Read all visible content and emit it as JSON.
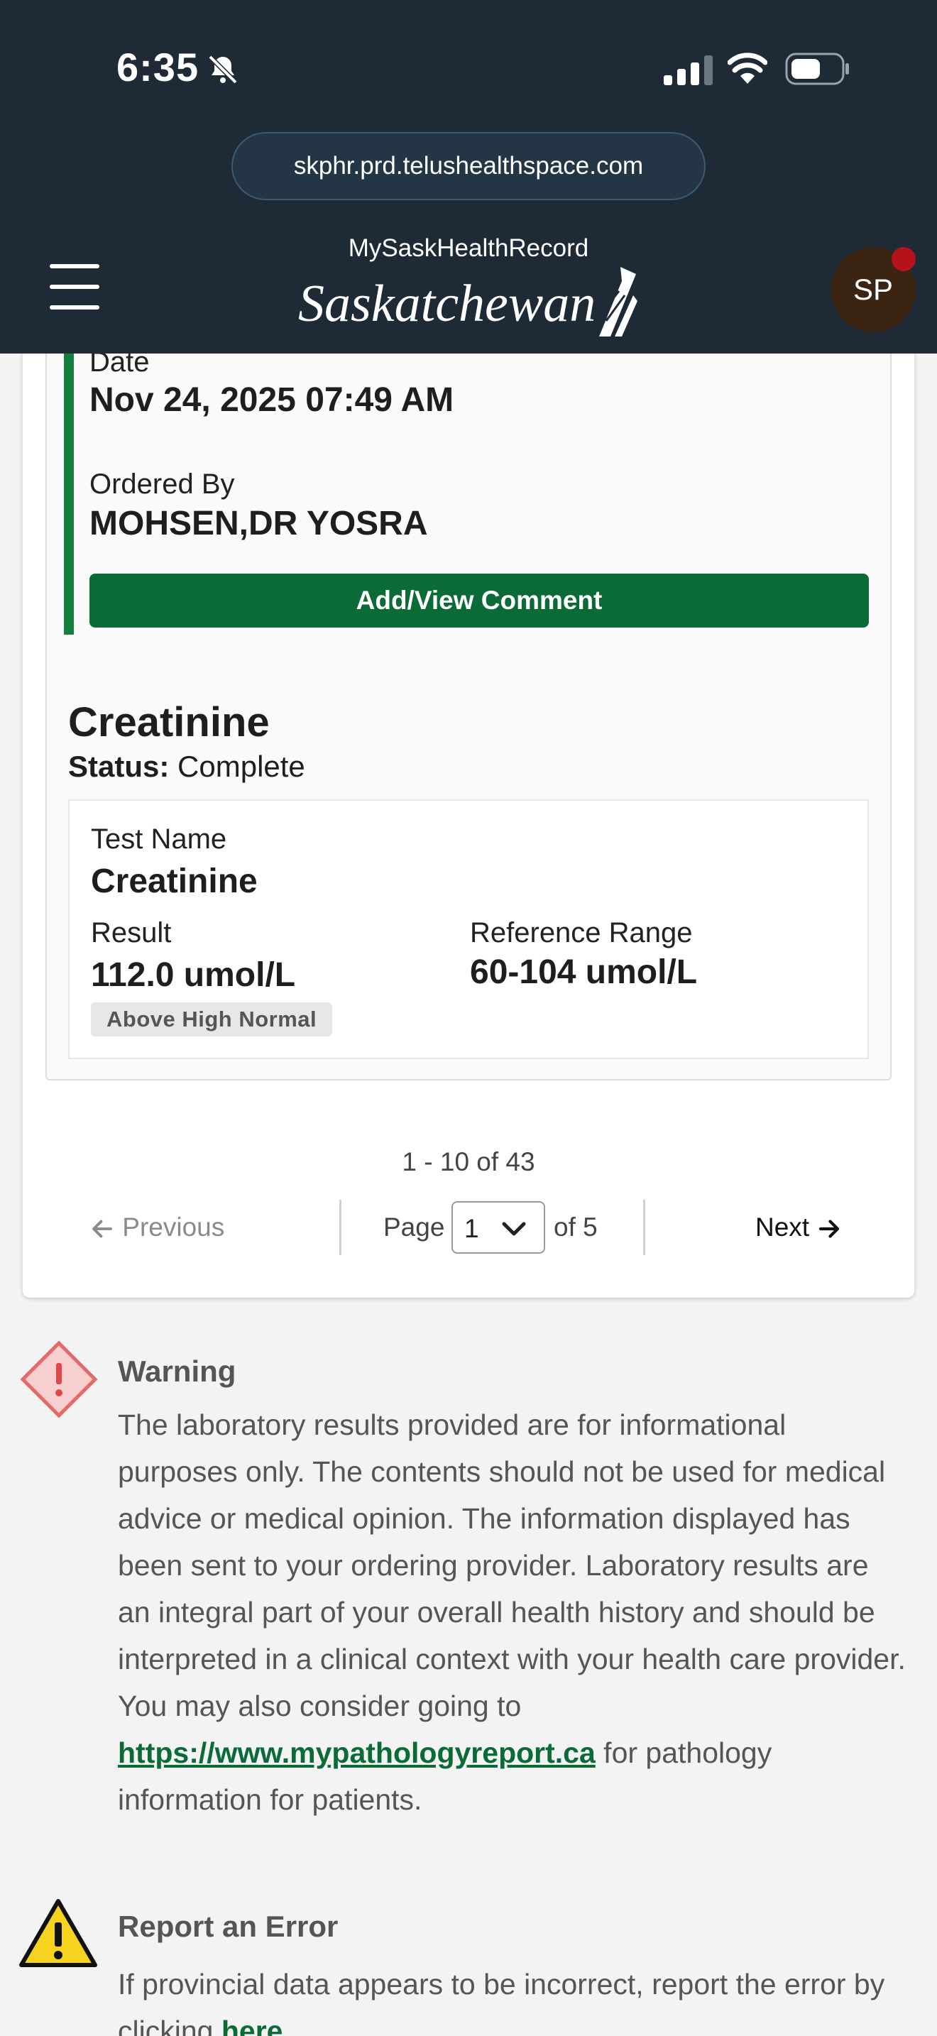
{
  "status_bar": {
    "time": "6:35"
  },
  "browser": {
    "url": "skphr.prd.telushealthspace.com"
  },
  "header": {
    "app_name": "MySaskHealthRecord",
    "logo_text": "Saskatchewan",
    "avatar_initials": "SP"
  },
  "result": {
    "date_label": "Date",
    "date_value": "Nov 24, 2025 07:49 AM",
    "ordered_by_label": "Ordered By",
    "ordered_by_value": "MOHSEN,DR YOSRA",
    "comment_button": "Add/View Comment",
    "title": "Creatinine",
    "status_label": "Status:",
    "status_value": "Complete",
    "test_name_label": "Test Name",
    "test_name_value": "Creatinine",
    "result_label": "Result",
    "result_value": "112.0 umol/L",
    "flag": "Above High Normal",
    "reference_range_label": "Reference Range",
    "reference_range_value": "60-104 umol/L"
  },
  "pagination": {
    "range": "1 - 10 of 43",
    "previous": "Previous",
    "page_label": "Page",
    "page_value": "1",
    "of_label": "of 5",
    "next": "Next"
  },
  "warning": {
    "title": "Warning",
    "text": "The laboratory results provided are for informational purposes only. The contents should not be used for medical advice or medical opinion. The information displayed has been sent to your ordering provider. Laboratory results are an integral part of your overall health history and should be interpreted in a clinical context with your health care provider. You may also consider going to",
    "link": "https://www.mypathologyreport.ca",
    "text_after": "for pathology information for patients."
  },
  "report_error": {
    "title": "Report an Error",
    "text": "If provincial data appears to be incorrect, report the error by clicking",
    "link": "here"
  },
  "colors": {
    "header_bg": "#1e2a35",
    "accent_green": "#0b6b36",
    "status_bar_green": "#15803d",
    "notification_dot": "#b5121b"
  },
  "icons": [
    "bell-off-icon",
    "signal-icon",
    "wifi-icon",
    "battery-icon",
    "menu-icon",
    "saskatchewan-logo-icon",
    "arrow-left-icon",
    "chevron-down-icon",
    "arrow-right-icon",
    "warning-diamond-icon",
    "warning-triangle-icon"
  ]
}
